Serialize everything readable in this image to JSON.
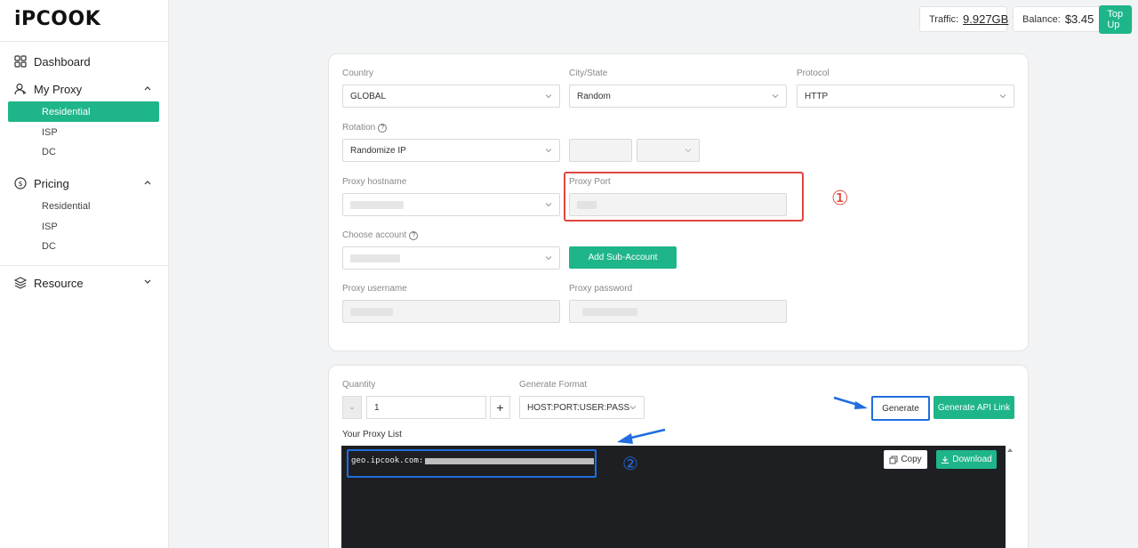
{
  "brand": {
    "logo": "iPCOOK",
    "accent": "#1fb58a"
  },
  "sidebar": {
    "dashboard": "Dashboard",
    "my_proxy": "My Proxy",
    "my_proxy_items": [
      "Residential",
      "ISP",
      "DC"
    ],
    "pricing": "Pricing",
    "pricing_items": [
      "Residential",
      "ISP",
      "DC"
    ],
    "resource": "Resource"
  },
  "header": {
    "traffic_label": "Traffic:",
    "traffic_value": "9.927GB",
    "balance_label": "Balance:",
    "balance_value": "$3.45",
    "topup": "Top Up"
  },
  "config": {
    "country_label": "Country",
    "country_value": "GLOBAL",
    "city_label": "City/State",
    "city_value": "Random",
    "protocol_label": "Protocol",
    "protocol_value": "HTTP",
    "rotation_label": "Rotation",
    "rotation_value": "Randomize IP",
    "hostname_label": "Proxy hostname",
    "port_label": "Proxy Port",
    "account_label": "Choose account",
    "add_sub_account": "Add Sub-Account",
    "username_label": "Proxy username",
    "password_label": "Proxy password"
  },
  "generate": {
    "quantity_label": "Quantity",
    "minus": "-",
    "quantity_value": "1",
    "plus": "+",
    "format_label": "Generate Format",
    "format_value": "HOST:PORT:USER:PASS",
    "generate_btn": "Generate",
    "api_btn": "Generate API Link",
    "list_label": "Your Proxy List",
    "proxy_line": "geo.ipcook.com:",
    "copy": "Copy",
    "download": "Download"
  },
  "annotations": {
    "marker_1": "①",
    "marker_2": "②"
  }
}
